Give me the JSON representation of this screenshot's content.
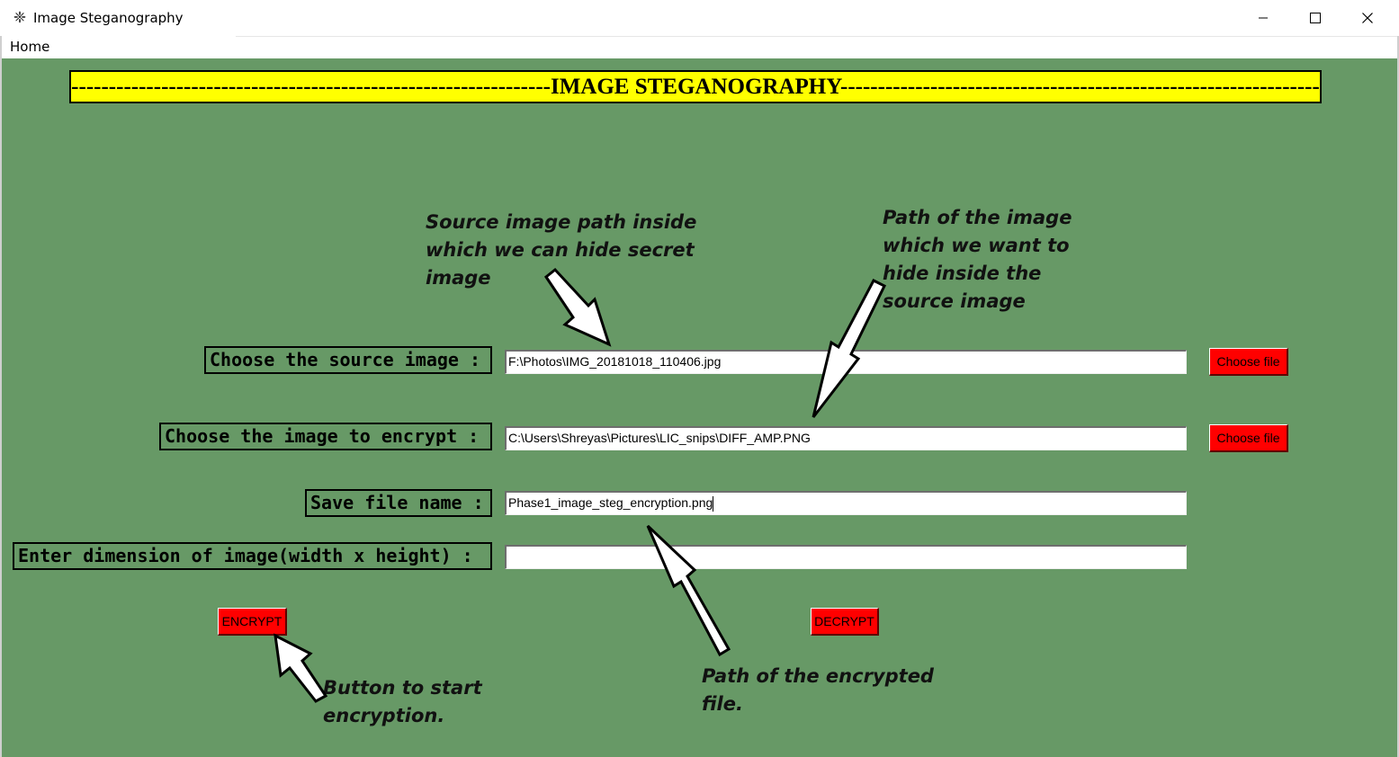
{
  "window": {
    "title": "Image Steganography",
    "app_icon": "feather-icon",
    "controls": [
      "minimize-icon",
      "maximize-icon",
      "close-icon"
    ]
  },
  "menu": {
    "home": "Home"
  },
  "banner": {
    "title": "---------------------------------------------------------------------------------------------------IMAGE STEGANOGRAPHY---------------------------------------------------------------------------------------------------"
  },
  "form": {
    "source_label": "Choose the source image :",
    "source_value": "F:\\Photos\\IMG_20181018_110406.jpg",
    "encrypt_label": "Choose the image to encrypt :",
    "encrypt_value": "C:\\Users\\Shreyas\\Pictures\\LIC_snips\\DIFF_AMP.PNG",
    "save_label": "Save file name :",
    "save_value": "Phase1_image_steg_encryption.png",
    "dimension_label": "Enter dimension of image(width x height) :",
    "dimension_value": "",
    "choose_file_1": "Choose file",
    "choose_file_2": "Choose file"
  },
  "buttons": {
    "encrypt": "ENCRYPT",
    "decrypt": "DECRYPT"
  },
  "annotations": {
    "source_path": "Source image path inside\nwhich we can hide secret\nimage",
    "hide_path": "Path of the image\nwhich we want to\nhide inside the\nsource image",
    "encrypted_path": "Path of the encrypted\nfile.",
    "start_button": "Button to start\nencryption."
  },
  "colors": {
    "background": "#679966",
    "banner": "#ffff00",
    "button": "#ff0000"
  }
}
